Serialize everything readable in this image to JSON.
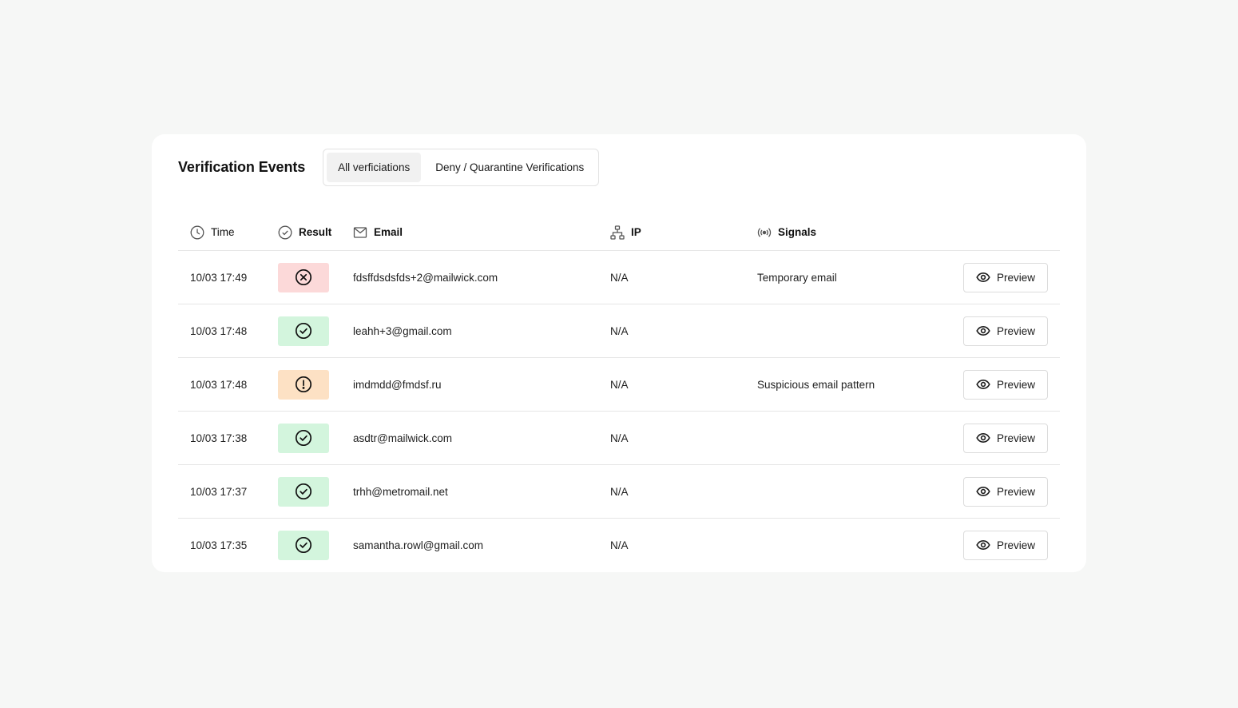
{
  "card": {
    "title": "Verification Events",
    "tabs": [
      {
        "label": "All verficiations",
        "active": true
      },
      {
        "label": "Deny / Quarantine Verifications",
        "active": false
      }
    ]
  },
  "table": {
    "columns": {
      "time": {
        "label": "Time",
        "icon": "clock-icon"
      },
      "result": {
        "label": "Result",
        "icon": "check-circle-icon"
      },
      "email": {
        "label": "Email",
        "icon": "mail-icon"
      },
      "ip": {
        "label": "IP",
        "icon": "network-icon"
      },
      "signals": {
        "label": "Signals",
        "icon": "broadcast-icon"
      }
    },
    "action_label": "Preview",
    "rows": [
      {
        "time": "10/03 17:49",
        "result": "deny",
        "email": "fdsffdsdsfds+2@mailwick.com",
        "ip": "N/A",
        "signals": "Temporary email"
      },
      {
        "time": "10/03 17:48",
        "result": "allow",
        "email": "leahh+3@gmail.com",
        "ip": "N/A",
        "signals": ""
      },
      {
        "time": "10/03 17:48",
        "result": "review",
        "email": "imdmdd@fmdsf.ru",
        "ip": "N/A",
        "signals": "Suspicious email pattern"
      },
      {
        "time": "10/03 17:38",
        "result": "allow",
        "email": "asdtr@mailwick.com",
        "ip": "N/A",
        "signals": ""
      },
      {
        "time": "10/03 17:37",
        "result": "allow",
        "email": "trhh@metromail.net",
        "ip": "N/A",
        "signals": ""
      },
      {
        "time": "10/03 17:35",
        "result": "allow",
        "email": "samantha.rowl@gmail.com",
        "ip": "N/A",
        "signals": ""
      }
    ]
  },
  "colors": {
    "deny_bg": "#fcd9d9",
    "allow_bg": "#d3f5dd",
    "review_bg": "#fde1c4"
  }
}
